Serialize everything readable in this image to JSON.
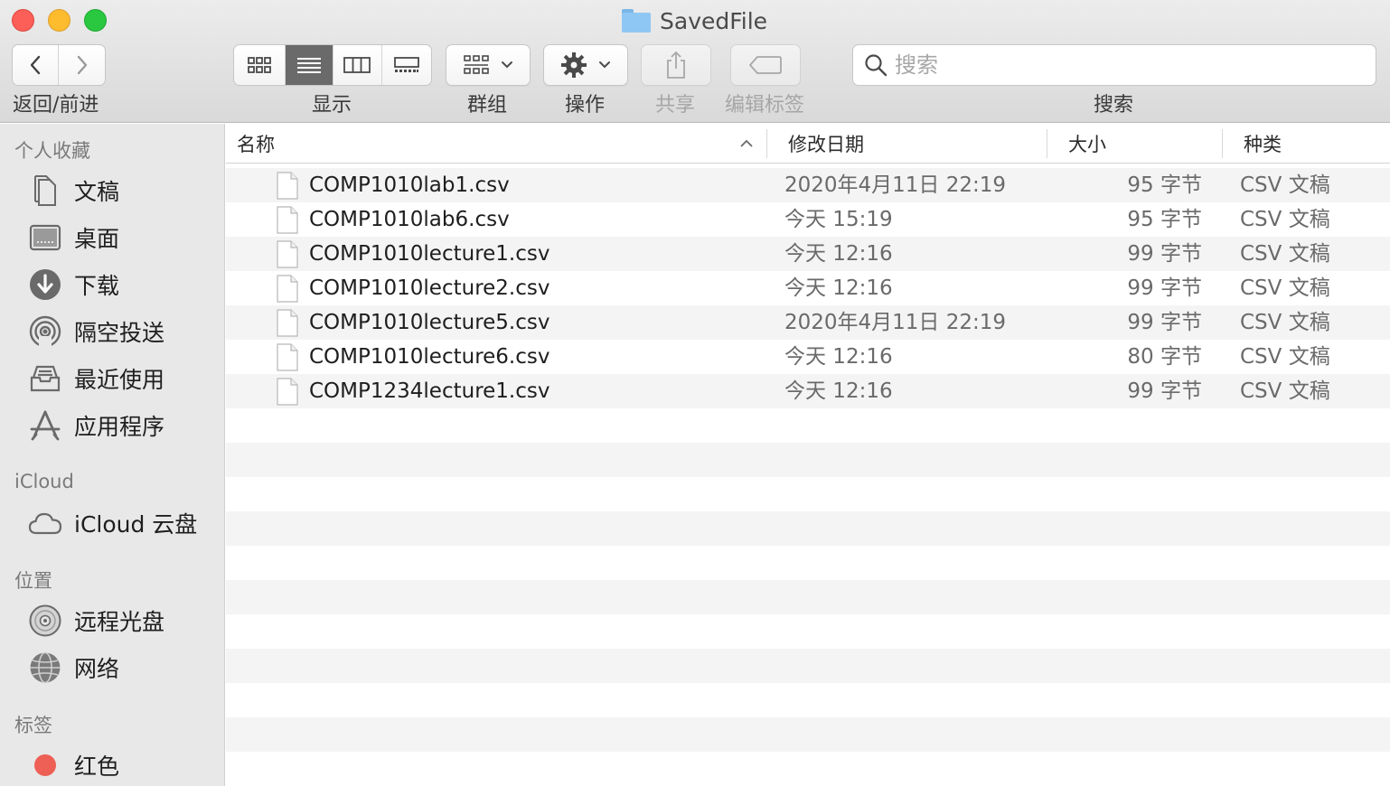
{
  "window": {
    "title": "SavedFile"
  },
  "toolbar": {
    "nav_label": "返回/前进",
    "view_label": "显示",
    "group_label": "群组",
    "action_label": "操作",
    "share_label": "共享",
    "tags_label": "编辑标签",
    "search_label": "搜索",
    "search_placeholder": "搜索",
    "active_view": "list"
  },
  "sidebar": {
    "favorites_heading": "个人收藏",
    "favorites": [
      {
        "label": "文稿",
        "icon": "document-icon"
      },
      {
        "label": "桌面",
        "icon": "desktop-icon"
      },
      {
        "label": "下载",
        "icon": "download-icon"
      },
      {
        "label": "隔空投送",
        "icon": "airdrop-icon"
      },
      {
        "label": "最近使用",
        "icon": "recents-icon"
      },
      {
        "label": "应用程序",
        "icon": "applications-icon"
      }
    ],
    "icloud_heading": "iCloud",
    "icloud": [
      {
        "label": "iCloud 云盘",
        "icon": "cloud-icon"
      }
    ],
    "locations_heading": "位置",
    "locations": [
      {
        "label": "远程光盘",
        "icon": "disc-icon"
      },
      {
        "label": "网络",
        "icon": "network-icon"
      }
    ],
    "tags_heading": "标签",
    "tags": [
      {
        "label": "红色",
        "icon": "tag-dot-icon",
        "color": "#ee5f55"
      }
    ]
  },
  "list": {
    "columns": {
      "name": "名称",
      "date": "修改日期",
      "size": "大小",
      "kind": "种类"
    },
    "sort": {
      "column": "name",
      "direction": "ascending"
    },
    "files": [
      {
        "name": "COMP1010lab1.csv",
        "date": "2020年4月11日 22:19",
        "size": "95 字节",
        "kind": "CSV 文稿"
      },
      {
        "name": "COMP1010lab6.csv",
        "date": "今天 15:19",
        "size": "95 字节",
        "kind": "CSV 文稿"
      },
      {
        "name": "COMP1010lecture1.csv",
        "date": "今天 12:16",
        "size": "99 字节",
        "kind": "CSV 文稿"
      },
      {
        "name": "COMP1010lecture2.csv",
        "date": "今天 12:16",
        "size": "99 字节",
        "kind": "CSV 文稿"
      },
      {
        "name": "COMP1010lecture5.csv",
        "date": "2020年4月11日 22:19",
        "size": "99 字节",
        "kind": "CSV 文稿"
      },
      {
        "name": "COMP1010lecture6.csv",
        "date": "今天 12:16",
        "size": "80 字节",
        "kind": "CSV 文稿"
      },
      {
        "name": "COMP1234lecture1.csv",
        "date": "今天 12:16",
        "size": "99 字节",
        "kind": "CSV 文稿"
      }
    ]
  }
}
